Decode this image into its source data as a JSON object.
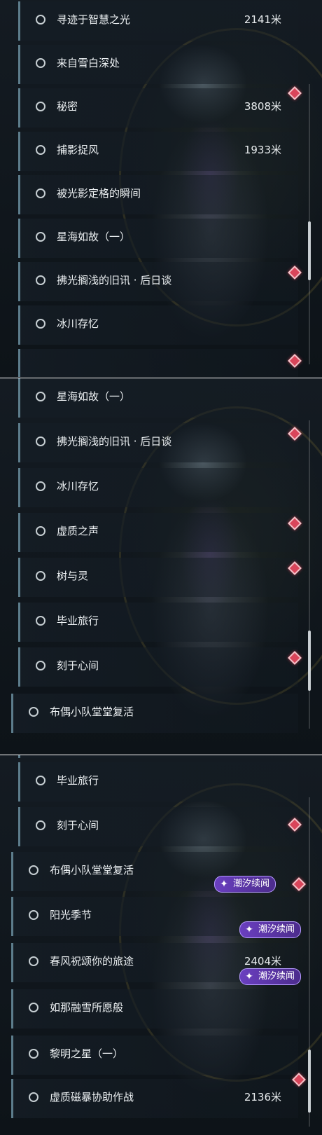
{
  "tag_label": "潮汐续闻",
  "tag_icon": "sparkle-icon",
  "marker_icon": "quest-marker-icon",
  "colors": {
    "accent_bar": "#5d7d8c",
    "marker": "#d9455a",
    "tag": "#6a3fbf"
  },
  "panel_a": {
    "rows": [
      {
        "label": "寻迹于智慧之光",
        "distance": "2141米"
      },
      {
        "label": "来自雪白深处",
        "distance": ""
      },
      {
        "label": "秘密",
        "distance": "3808米"
      },
      {
        "label": "捕影捉风",
        "distance": "1933米"
      },
      {
        "label": "被光影定格的瞬间",
        "distance": ""
      },
      {
        "label": "星海如故（一）",
        "distance": ""
      },
      {
        "label": "拂光搁浅的旧讯 · 后日谈",
        "distance": ""
      },
      {
        "label": "冰川存忆",
        "distance": ""
      }
    ]
  },
  "panel_b": {
    "rows": [
      {
        "label": "星海如故（一）",
        "distance": ""
      },
      {
        "label": "拂光搁浅的旧讯 · 后日谈",
        "distance": ""
      },
      {
        "label": "冰川存忆",
        "distance": ""
      },
      {
        "label": "虚质之声",
        "distance": ""
      },
      {
        "label": "树与灵",
        "distance": ""
      },
      {
        "label": "毕业旅行",
        "distance": ""
      },
      {
        "label": "刻于心间",
        "distance": ""
      },
      {
        "label": "布偶小队堂堂复活",
        "distance": ""
      }
    ]
  },
  "panel_c": {
    "rows": [
      {
        "label": "毕业旅行",
        "distance": ""
      },
      {
        "label": "刻于心间",
        "distance": ""
      },
      {
        "label": "布偶小队堂堂复活",
        "distance": ""
      },
      {
        "label": "阳光季节",
        "distance": ""
      },
      {
        "label": "春风祝颂你的旅途",
        "distance": "2404米"
      },
      {
        "label": "如那融雪所愿般",
        "distance": ""
      },
      {
        "label": "黎明之星（一）",
        "distance": ""
      },
      {
        "label": "虚质磁暴协助作战",
        "distance": "2136米"
      }
    ]
  }
}
